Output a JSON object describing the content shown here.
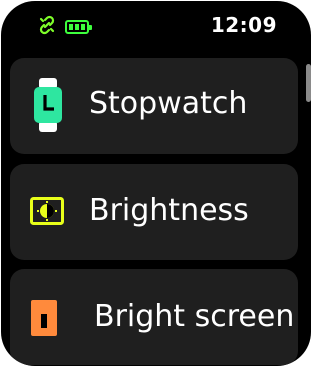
{
  "status_bar": {
    "time": "12:09",
    "link_icon": "unlink-icon",
    "battery_icon": "battery-icon",
    "battery_color": "#3dff3d",
    "link_color": "#7fff2a"
  },
  "menu": {
    "items": [
      {
        "label": "Stopwatch",
        "icon": "stopwatch-icon",
        "icon_color": "#2ee6a0"
      },
      {
        "label": "Brightness",
        "icon": "brightness-icon",
        "icon_color": "#e8ff1a"
      },
      {
        "label": "Bright screen",
        "icon": "bright-screen-icon",
        "icon_color": "#ff8a3c"
      }
    ]
  }
}
